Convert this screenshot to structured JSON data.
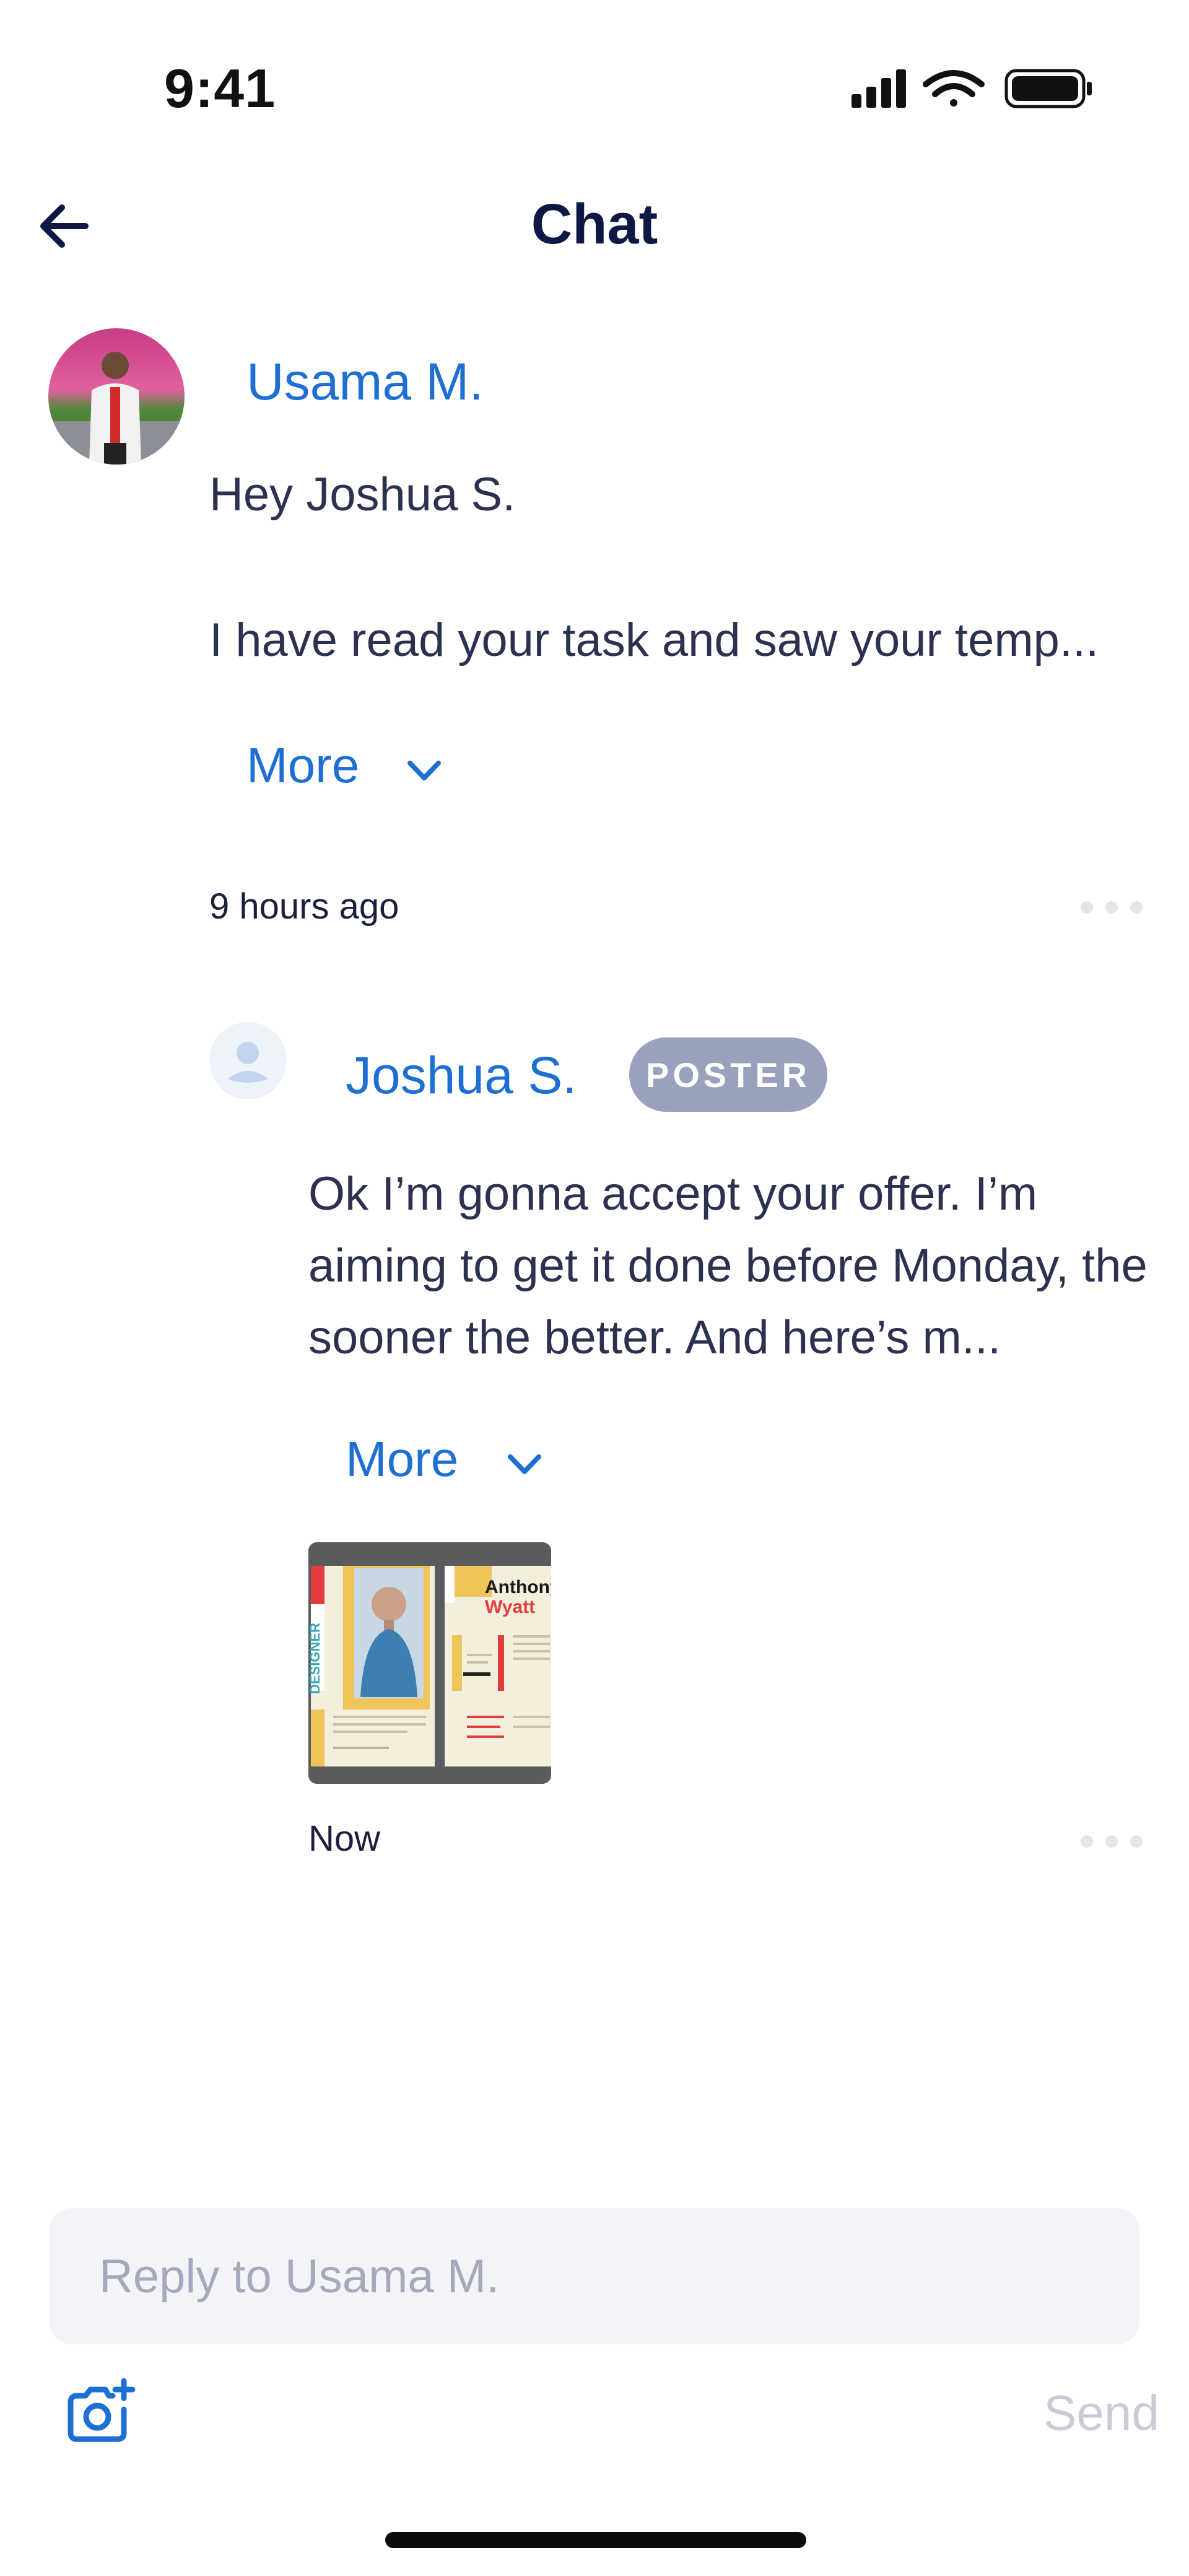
{
  "status_bar": {
    "time": "9:41"
  },
  "header": {
    "title": "Chat"
  },
  "messages": [
    {
      "name": "Usama M.",
      "line1": "Hey Joshua S.",
      "line2": "I have read your task and saw your temp...",
      "more": "More",
      "time": "9 hours ago"
    },
    {
      "name": "Joshua S.",
      "badge": "POSTER",
      "text": "Ok I’m gonna accept your offer. I’m aiming to get it done before Monday, the sooner the better. And here’s m...",
      "more": "More",
      "attachment": {
        "label_first": "Anthony",
        "label_last": "Wyatt",
        "side_text": "DESIGNER"
      },
      "time": "Now"
    }
  ],
  "composer": {
    "placeholder": "Reply to Usama M.",
    "send": "Send"
  },
  "colors": {
    "accent": "#1e6fd3",
    "title": "#0f1744",
    "badge": "#9aa1bd",
    "send_disabled": "#c9ccd6"
  },
  "icons": [
    "back-arrow-icon",
    "signal-icon",
    "wifi-icon",
    "battery-icon",
    "chevron-down-icon",
    "more-dots-icon",
    "person-icon",
    "camera-add-icon"
  ]
}
